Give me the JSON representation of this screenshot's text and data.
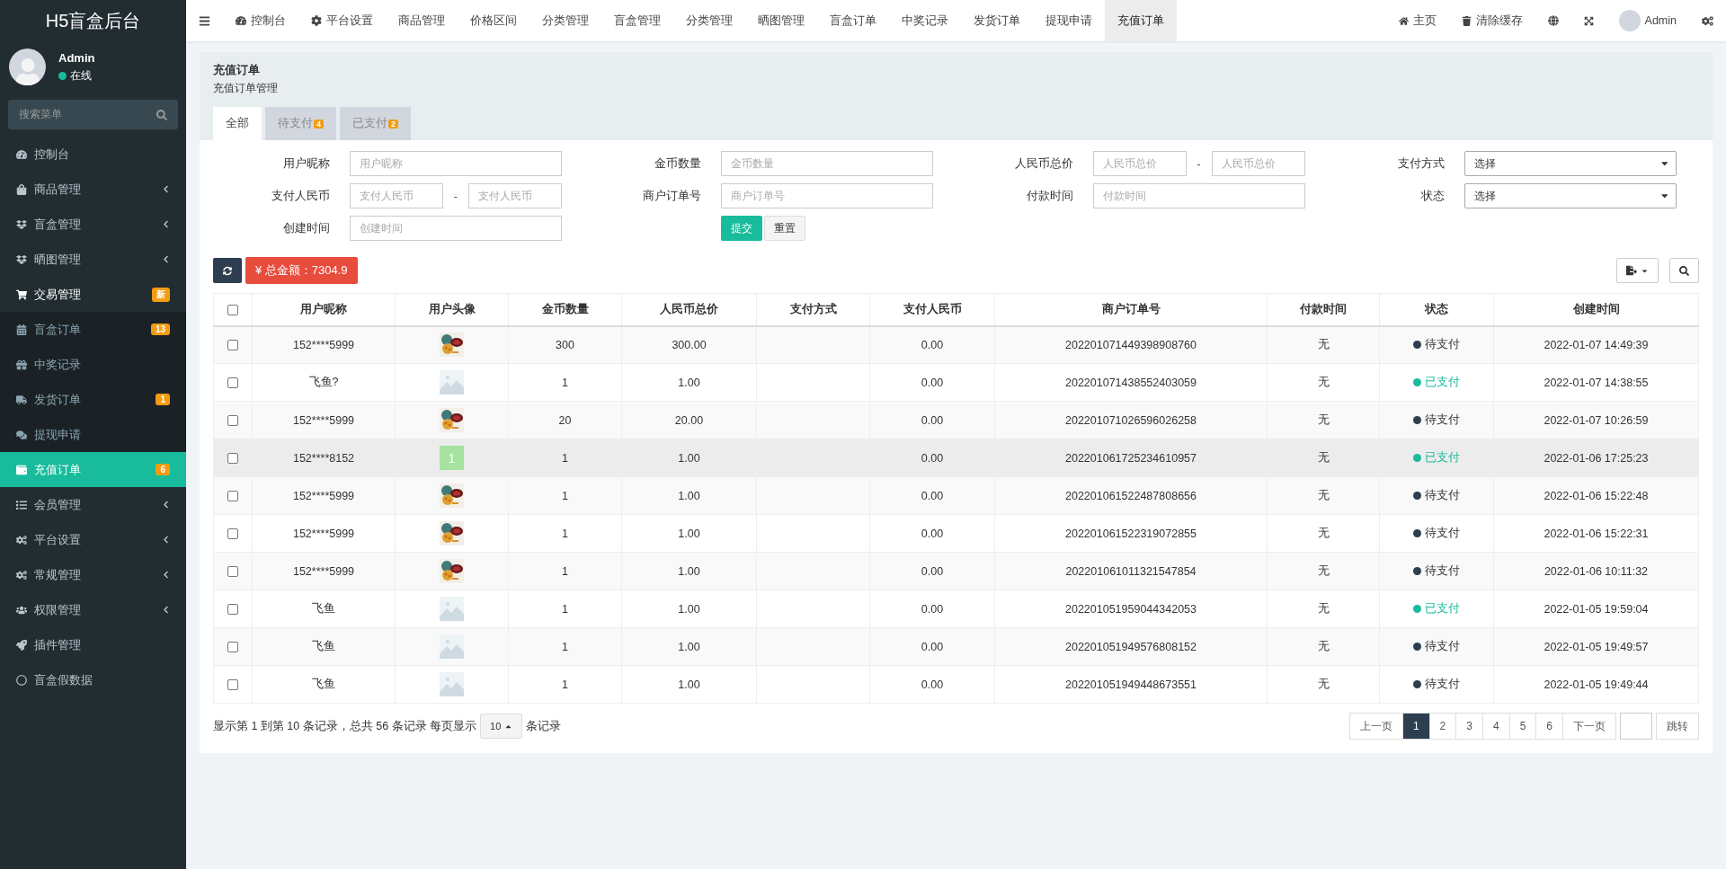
{
  "sidebar": {
    "title": "H5盲盒后台",
    "user": {
      "name": "Admin",
      "status": "在线",
      "online": true
    },
    "search": {
      "placeholder": "搜索菜单"
    },
    "items": [
      {
        "label": "控制台",
        "expandable": false,
        "selected": false
      },
      {
        "label": "商品管理",
        "expandable": true,
        "selected": false
      },
      {
        "label": "盲盒管理",
        "expandable": true,
        "selected": false
      },
      {
        "label": "晒图管理",
        "expandable": true,
        "selected": false
      },
      {
        "label": "交易管理",
        "expandable": false,
        "selected": false,
        "badge": "新",
        "expanded": true,
        "children": [
          {
            "label": "盲盒订单",
            "badge": "13",
            "selected": false
          },
          {
            "label": "中奖记录",
            "selected": false
          },
          {
            "label": "发货订单",
            "badge": "1",
            "selected": false
          },
          {
            "label": "提现申请",
            "selected": false
          }
        ]
      },
      {
        "label": "充值订单",
        "expandable": false,
        "selected": true,
        "badge": "6"
      },
      {
        "label": "会员管理",
        "expandable": true,
        "selected": false
      },
      {
        "label": "平台设置",
        "expandable": true,
        "selected": false
      },
      {
        "label": "常规管理",
        "expandable": true,
        "selected": false
      },
      {
        "label": "权限管理",
        "expandable": true,
        "selected": false
      },
      {
        "label": "插件管理",
        "expandable": false,
        "selected": false
      },
      {
        "label": "盲盒假数据",
        "expandable": false,
        "selected": false
      }
    ]
  },
  "topbar": {
    "tabs": [
      {
        "label": "控制台",
        "selected": false
      },
      {
        "label": "平台设置",
        "selected": false
      },
      {
        "label": "商品管理",
        "selected": false
      },
      {
        "label": "价格区间",
        "selected": false
      },
      {
        "label": "分类管理",
        "selected": false
      },
      {
        "label": "盲盒管理",
        "selected": false
      },
      {
        "label": "分类管理",
        "selected": false
      },
      {
        "label": "晒图管理",
        "selected": false
      },
      {
        "label": "盲盒订单",
        "selected": false
      },
      {
        "label": "中奖记录",
        "selected": false
      },
      {
        "label": "发货订单",
        "selected": false
      },
      {
        "label": "提现申请",
        "selected": false
      },
      {
        "label": "充值订单",
        "selected": true
      }
    ],
    "links": [
      "主页",
      "清除缓存"
    ],
    "user": "Admin"
  },
  "page": {
    "title": "充值订单",
    "subtitle": "充值订单管理",
    "tabs": [
      {
        "label": "全部",
        "selected": true
      },
      {
        "label": "待支付",
        "badge": "4",
        "selected": false
      },
      {
        "label": "已支付",
        "badge": "2",
        "selected": false
      }
    ],
    "filters": [
      {
        "label": "用户昵称",
        "kind": "text",
        "placeholder": "用户昵称"
      },
      {
        "label": "金币数量",
        "kind": "text",
        "placeholder": "金币数量"
      },
      {
        "label": "人民币总价",
        "kind": "range",
        "fields": [
          {
            "placeholder": "人民币总价"
          },
          {
            "placeholder": "人民币总价"
          }
        ],
        "separator": "-"
      },
      {
        "label": "支付方式",
        "kind": "select",
        "value": "选择"
      },
      {
        "label": "支付人民币",
        "kind": "range",
        "fields": [
          {
            "placeholder": "支付人民币"
          },
          {
            "placeholder": "支付人民币"
          }
        ],
        "separator": "-"
      },
      {
        "label": "商户订单号",
        "kind": "text",
        "placeholder": "商户订单号"
      },
      {
        "label": "付款时间",
        "kind": "text",
        "placeholder": "付款时间"
      },
      {
        "label": "状态",
        "kind": "select",
        "value": "选择"
      },
      {
        "label": "创建时间",
        "kind": "text",
        "placeholder": "创建时间"
      },
      {
        "kind": "buttons",
        "submit": "提交",
        "reset": "重置"
      }
    ],
    "total": "¥ 总金额：7304.9",
    "table": {
      "select_all": {
        "checked": false
      },
      "columns": [
        "用户昵称",
        "用户头像",
        "金币数量",
        "人民币总价",
        "支付方式",
        "支付人民币",
        "商户订单号",
        "付款时间",
        "状态",
        "创建时间"
      ],
      "rows": [
        {
          "checked": false,
          "hovered": false,
          "nickname": "152****5999",
          "coins": "300",
          "rmb_total": "300.00",
          "pay_rmb": "0.00",
          "order_no": "202201071449398908760",
          "paid_at": "无",
          "status": {
            "text": "待支付",
            "color": "#2c3e50"
          },
          "created": "2022-01-07 14:49:39"
        },
        {
          "checked": false,
          "hovered": false,
          "nickname": "飞鱼?",
          "avatar": {
            "kind": "placeholder"
          },
          "coins": "1",
          "rmb_total": "1.00",
          "pay_rmb": "0.00",
          "order_no": "202201071438552403059",
          "paid_at": "无",
          "status": {
            "text": "已支付",
            "color": "#18bc9c"
          },
          "created": "2022-01-07 14:38:55"
        },
        {
          "checked": false,
          "hovered": false,
          "nickname": "152****5999",
          "coins": "20",
          "rmb_total": "20.00",
          "pay_rmb": "0.00",
          "order_no": "202201071026596026258",
          "paid_at": "无",
          "status": {
            "text": "待支付",
            "color": "#2c3e50"
          },
          "created": "2022-01-07 10:26:59"
        },
        {
          "checked": false,
          "hovered": true,
          "nickname": "152****8152",
          "avatar": {
            "kind": "letter",
            "text": "1"
          },
          "coins": "1",
          "rmb_total": "1.00",
          "pay_rmb": "0.00",
          "order_no": "202201061725234610957",
          "paid_at": "无",
          "status": {
            "text": "已支付",
            "color": "#18bc9c"
          },
          "created": "2022-01-06 17:25:23"
        },
        {
          "checked": false,
          "hovered": false,
          "nickname": "152****5999",
          "coins": "1",
          "rmb_total": "1.00",
          "pay_rmb": "0.00",
          "order_no": "202201061522487808656",
          "paid_at": "无",
          "status": {
            "text": "待支付",
            "color": "#2c3e50"
          },
          "created": "2022-01-06 15:22:48"
        },
        {
          "checked": false,
          "hovered": false,
          "nickname": "152****5999",
          "coins": "1",
          "rmb_total": "1.00",
          "pay_rmb": "0.00",
          "order_no": "202201061522319072855",
          "paid_at": "无",
          "status": {
            "text": "待支付",
            "color": "#2c3e50"
          },
          "created": "2022-01-06 15:22:31"
        },
        {
          "checked": false,
          "hovered": false,
          "nickname": "152****5999",
          "coins": "1",
          "rmb_total": "1.00",
          "pay_rmb": "0.00",
          "order_no": "202201061011321547854",
          "paid_at": "无",
          "status": {
            "text": "待支付",
            "color": "#2c3e50"
          },
          "created": "2022-01-06 10:11:32"
        },
        {
          "checked": false,
          "hovered": false,
          "nickname": "飞鱼",
          "avatar": {
            "kind": "placeholder"
          },
          "coins": "1",
          "rmb_total": "1.00",
          "pay_rmb": "0.00",
          "order_no": "202201051959044342053",
          "paid_at": "无",
          "status": {
            "text": "已支付",
            "color": "#18bc9c"
          },
          "created": "2022-01-05 19:59:04"
        },
        {
          "checked": false,
          "hovered": false,
          "nickname": "飞鱼",
          "avatar": {
            "kind": "placeholder"
          },
          "coins": "1",
          "rmb_total": "1.00",
          "pay_rmb": "0.00",
          "order_no": "202201051949576808152",
          "paid_at": "无",
          "status": {
            "text": "待支付",
            "color": "#2c3e50"
          },
          "created": "2022-01-05 19:49:57"
        },
        {
          "checked": false,
          "hovered": false,
          "nickname": "飞鱼",
          "avatar": {
            "kind": "placeholder"
          },
          "coins": "1",
          "rmb_total": "1.00",
          "pay_rmb": "0.00",
          "order_no": "202201051949448673551",
          "paid_at": "无",
          "status": {
            "text": "待支付",
            "color": "#2c3e50"
          },
          "created": "2022-01-05 19:49:44"
        }
      ]
    },
    "footer": {
      "summary": "显示第 1 到第 10 条记录，总共 56 条记录 每页显示",
      "page_size": "10",
      "suffix": "条记录",
      "pager": [
        {
          "label": "上一页",
          "selected": false
        },
        {
          "label": "1",
          "selected": true
        },
        {
          "label": "2",
          "selected": false
        },
        {
          "label": "3",
          "selected": false
        },
        {
          "label": "4",
          "selected": false
        },
        {
          "label": "5",
          "selected": false
        },
        {
          "label": "6",
          "selected": false
        },
        {
          "label": "下一页",
          "selected": false
        }
      ],
      "jump": "跳转"
    }
  }
}
